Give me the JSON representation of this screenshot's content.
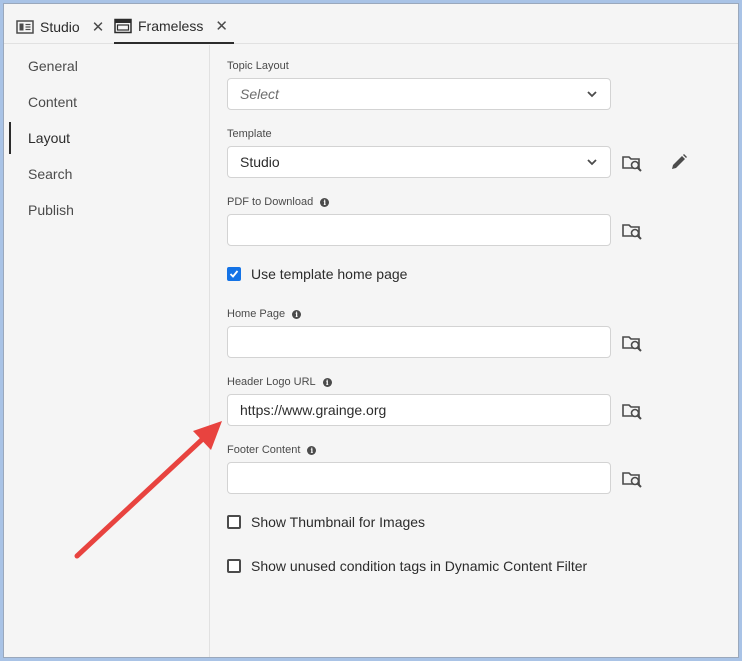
{
  "tabs": [
    {
      "label": "Studio",
      "close": "✕"
    },
    {
      "label": "Frameless",
      "close": "✕"
    }
  ],
  "sidebar": {
    "items": [
      {
        "label": "General"
      },
      {
        "label": "Content"
      },
      {
        "label": "Layout",
        "active": true
      },
      {
        "label": "Search"
      },
      {
        "label": "Publish"
      }
    ]
  },
  "form": {
    "topic_layout": {
      "label": "Topic Layout",
      "placeholder": "Select"
    },
    "template": {
      "label": "Template",
      "value": "Studio"
    },
    "pdf_download": {
      "label": "PDF to Download",
      "value": ""
    },
    "use_home": {
      "label": "Use template home page",
      "checked": true
    },
    "home_page": {
      "label": "Home Page",
      "value": ""
    },
    "header_logo": {
      "label": "Header Logo URL",
      "value": "https://www.grainge.org"
    },
    "footer": {
      "label": "Footer Content",
      "value": ""
    },
    "show_thumb": {
      "label": "Show Thumbnail for Images",
      "checked": false
    },
    "show_unused": {
      "label": "Show unused condition tags in Dynamic Content Filter",
      "checked": false
    }
  },
  "colors": {
    "accent": "#1473e6",
    "annotation_arrow": "#e8433f",
    "frame_border": "#a9c3e6"
  },
  "icons": [
    "studio-tab-icon",
    "frameless-tab-icon",
    "close-icon",
    "chevron-down-icon",
    "browse-folder-icon",
    "pencil-icon",
    "info-icon",
    "checkmark-icon"
  ]
}
